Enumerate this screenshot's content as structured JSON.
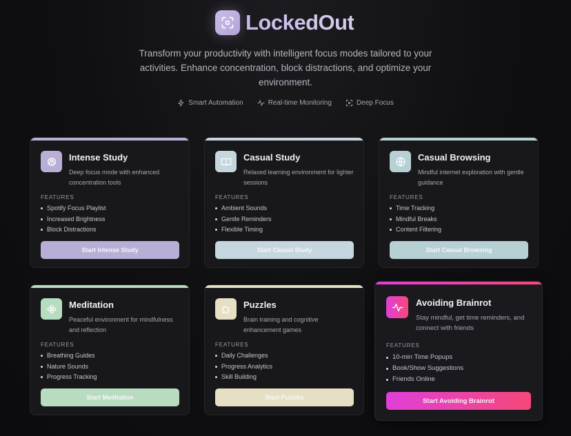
{
  "app": {
    "title": "LockedOut",
    "subtitle": "Transform your productivity with intelligent focus modes tailored to your activities. Enhance concentration, block distractions, and optimize your environment."
  },
  "badges": [
    {
      "label": "Smart Automation",
      "icon": "lightning-icon"
    },
    {
      "label": "Real-time Monitoring",
      "icon": "activity-icon"
    },
    {
      "label": "Deep Focus",
      "icon": "focus-icon"
    }
  ],
  "features_label": "FEATURES",
  "cards": [
    {
      "title": "Intense Study",
      "description": "Deep focus mode with enhanced concentration tools",
      "icon": "brain-icon",
      "features": [
        "Spotify Focus Playlist",
        "Increased Brightness",
        "Block Distractions"
      ],
      "button": "Start Intense Study",
      "color": "#b9aed6"
    },
    {
      "title": "Casual Study",
      "description": "Relaxed learning environment for lighter sessions",
      "icon": "book-icon",
      "features": [
        "Ambient Sounds",
        "Gentle Reminders",
        "Flexible Timing"
      ],
      "button": "Start Casual Study",
      "color": "#c6d6de"
    },
    {
      "title": "Casual Browsing",
      "description": "Mindful internet exploration with gentle guidance",
      "icon": "globe-icon",
      "features": [
        "Time Tracking",
        "Mindful Breaks",
        "Content Filtering"
      ],
      "button": "Start Casual Browsing",
      "color": "#b7d0d4"
    },
    {
      "title": "Meditation",
      "description": "Peaceful environment for mindfulness and reflection",
      "icon": "flower-icon",
      "features": [
        "Breathing Guides",
        "Nature Sounds",
        "Progress Tracking"
      ],
      "button": "Start Meditation",
      "color": "#b8dcc0"
    },
    {
      "title": "Puzzles",
      "description": "Brain training and cognitive enhancement games",
      "icon": "puzzle-icon",
      "features": [
        "Daily Challenges",
        "Progress Analytics",
        "Skill Building"
      ],
      "button": "Start Puzzles",
      "color": "#e5e0c3"
    },
    {
      "title": "Avoiding Brainrot",
      "description": "Stay mindful, get time reminders, and connect with friends",
      "icon": "pulse-icon",
      "features": [
        "10-min Time Popups",
        "Book/Show Suggestions",
        "Friends Online"
      ],
      "button": "Start Avoiding Brainrot",
      "color": "#e03fd8",
      "color2": "#f5487a"
    }
  ]
}
